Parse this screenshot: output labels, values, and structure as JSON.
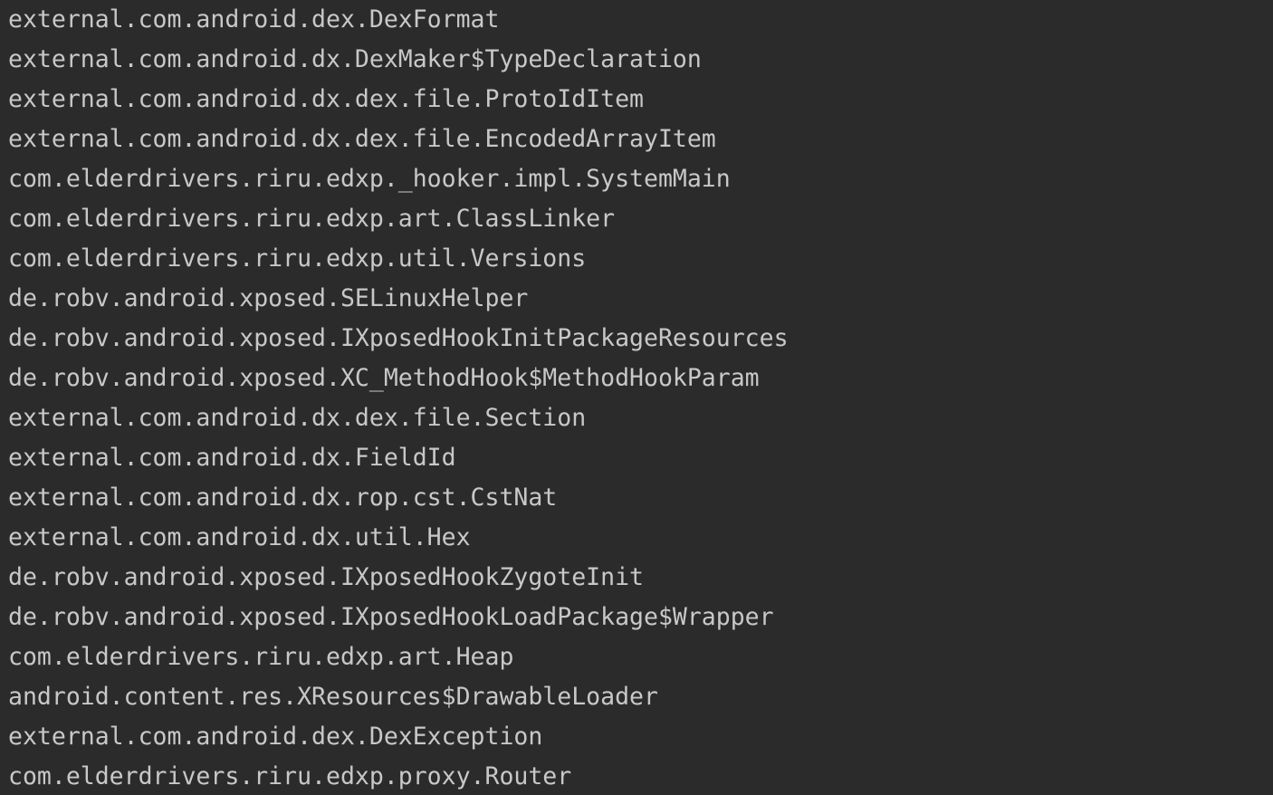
{
  "console": {
    "lines": [
      "external.com.android.dex.DexFormat",
      "external.com.android.dx.DexMaker$TypeDeclaration",
      "external.com.android.dx.dex.file.ProtoIdItem",
      "external.com.android.dx.dex.file.EncodedArrayItem",
      "com.elderdrivers.riru.edxp._hooker.impl.SystemMain",
      "com.elderdrivers.riru.edxp.art.ClassLinker",
      "com.elderdrivers.riru.edxp.util.Versions",
      "de.robv.android.xposed.SELinuxHelper",
      "de.robv.android.xposed.IXposedHookInitPackageResources",
      "de.robv.android.xposed.XC_MethodHook$MethodHookParam",
      "external.com.android.dx.dex.file.Section",
      "external.com.android.dx.FieldId",
      "external.com.android.dx.rop.cst.CstNat",
      "external.com.android.dx.util.Hex",
      "de.robv.android.xposed.IXposedHookZygoteInit",
      "de.robv.android.xposed.IXposedHookLoadPackage$Wrapper",
      "com.elderdrivers.riru.edxp.art.Heap",
      "android.content.res.XResources$DrawableLoader",
      "external.com.android.dex.DexException",
      "com.elderdrivers.riru.edxp.proxy.Router"
    ]
  },
  "colors": {
    "background": "#2b2b2b",
    "text": "#c8c8c8"
  }
}
